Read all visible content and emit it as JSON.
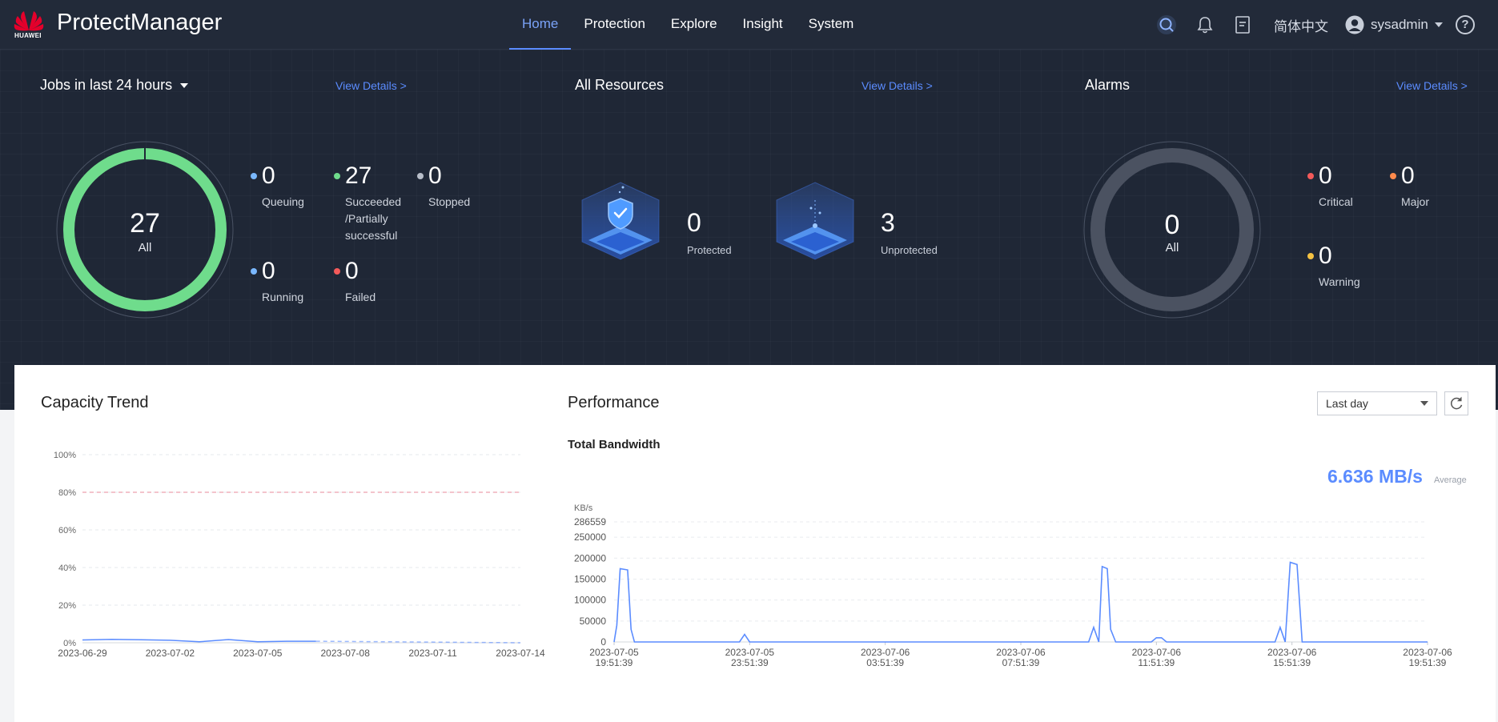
{
  "header": {
    "logo_text": "HUAWEI",
    "app_title": "ProtectManager",
    "nav": [
      {
        "label": "Home",
        "active": true
      },
      {
        "label": "Protection",
        "active": false
      },
      {
        "label": "Explore",
        "active": false
      },
      {
        "label": "Insight",
        "active": false
      },
      {
        "label": "System",
        "active": false
      }
    ],
    "icons": [
      "search-icon",
      "bell-icon",
      "document-icon"
    ],
    "language": "简体中文",
    "user": "sysadmin",
    "help": "?"
  },
  "jobs": {
    "title": "Jobs in last 24 hours",
    "view_details": "View Details >",
    "total": "27",
    "total_label": "All",
    "stats": [
      {
        "value": "0",
        "label": "Queuing",
        "color": "#7ab8ff"
      },
      {
        "value": "27",
        "label": "Succeeded /Partially successful",
        "color": "#6fdc8c"
      },
      {
        "value": "0",
        "label": "Stopped",
        "color": "#b8bec9"
      },
      {
        "value": "0",
        "label": "Running",
        "color": "#7ab8ff"
      },
      {
        "value": "0",
        "label": "Failed",
        "color": "#f45a5a"
      }
    ]
  },
  "resources": {
    "title": "All Resources",
    "view_details": "View Details >",
    "protected": {
      "value": "0",
      "label": "Protected"
    },
    "unprotected": {
      "value": "3",
      "label": "Unprotected"
    }
  },
  "alarms": {
    "title": "Alarms",
    "view_details": "View Details >",
    "total": "0",
    "total_label": "All",
    "stats": [
      {
        "value": "0",
        "label": "Critical",
        "color": "#f45a5a"
      },
      {
        "value": "0",
        "label": "Major",
        "color": "#ff8a4c"
      },
      {
        "value": "0",
        "label": "Warning",
        "color": "#f5c242"
      }
    ]
  },
  "capacity": {
    "title": "Capacity Trend"
  },
  "performance": {
    "title": "Performance",
    "subtitle": "Total Bandwidth",
    "average_value": "6.636 MB/s",
    "average_label": "Average",
    "range_select": "Last day"
  },
  "chart_data": [
    {
      "type": "line",
      "title": "Capacity Trend",
      "y_unit": "%",
      "ylim": [
        0,
        100
      ],
      "y_ticks": [
        "100%",
        "80%",
        "60%",
        "40%",
        "20%",
        "0%"
      ],
      "x_ticks": [
        "2023-06-29",
        "2023-07-02",
        "2023-07-05",
        "2023-07-08",
        "2023-07-11",
        "2023-07-14"
      ],
      "threshold": 80,
      "series": [
        {
          "style": "solid",
          "x": [
            "2023-06-29",
            "2023-06-30",
            "2023-07-01",
            "2023-07-02",
            "2023-07-03",
            "2023-07-04",
            "2023-07-05",
            "2023-07-06",
            "2023-07-07"
          ],
          "values": [
            1.5,
            1.8,
            1.6,
            1.3,
            0.5,
            1.7,
            0.5,
            0.8,
            0.8
          ]
        },
        {
          "style": "dashed",
          "x": [
            "2023-07-07",
            "2023-07-14"
          ],
          "values": [
            0.8,
            0.0
          ]
        }
      ]
    },
    {
      "type": "line",
      "title": "Total Bandwidth",
      "y_unit": "KB/s",
      "ylim": [
        0,
        286559
      ],
      "y_ticks": [
        "286559",
        "250000",
        "200000",
        "150000",
        "100000",
        "50000",
        "0"
      ],
      "x_ticks": [
        [
          "2023-07-05",
          "19:51:39"
        ],
        [
          "2023-07-05",
          "23:51:39"
        ],
        [
          "2023-07-06",
          "03:51:39"
        ],
        [
          "2023-07-06",
          "07:51:39"
        ],
        [
          "2023-07-06",
          "11:51:39"
        ],
        [
          "2023-07-06",
          "15:51:39"
        ],
        [
          "2023-07-06",
          "19:51:39"
        ]
      ],
      "x_hours": [
        0,
        0.08,
        0.18,
        0.4,
        0.5,
        0.6,
        3.7,
        3.85,
        4.0,
        14.0,
        14.15,
        14.3,
        14.4,
        14.55,
        14.65,
        14.8,
        15.85,
        16.0,
        16.15,
        16.3,
        19.5,
        19.65,
        19.8,
        19.95,
        20.15,
        20.3,
        24
      ],
      "values": [
        0,
        40000,
        175000,
        172000,
        30000,
        0,
        0,
        18000,
        0,
        0,
        35000,
        0,
        180000,
        175000,
        30000,
        0,
        0,
        10000,
        10000,
        0,
        0,
        35000,
        0,
        190000,
        185000,
        0,
        0
      ]
    }
  ]
}
